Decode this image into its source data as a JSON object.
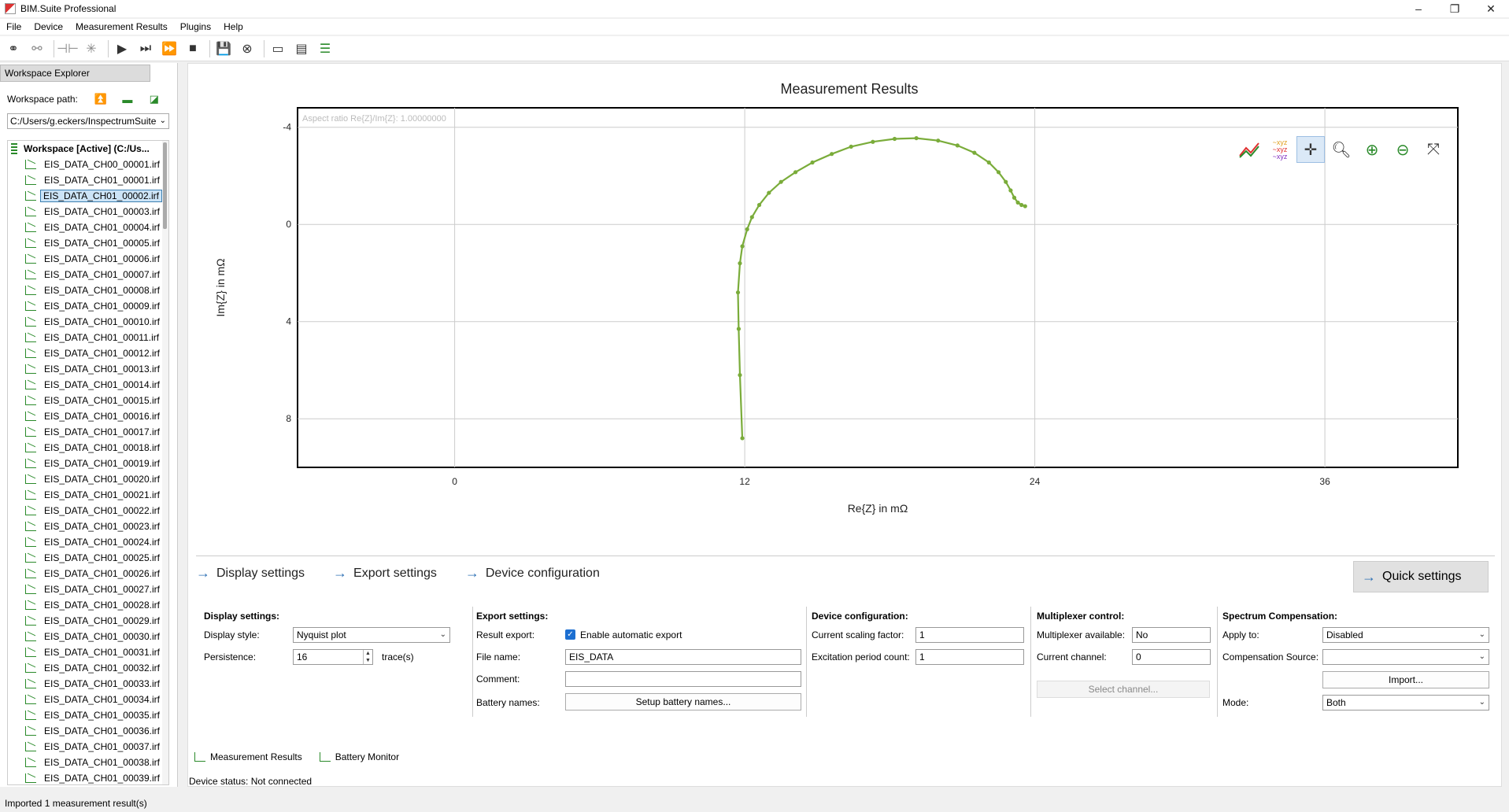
{
  "window": {
    "title": "BIM.Suite Professional",
    "controls": [
      "–",
      "❐",
      "✕"
    ]
  },
  "menu": [
    "File",
    "Device",
    "Measurement Results",
    "Plugins",
    "Help"
  ],
  "left": {
    "header": "Workspace Explorer",
    "workspace_label": "Workspace path:",
    "workspace_path": "C:/Users/g.eckers/InspectrumSuite",
    "root": "Workspace [Active] (C:/Us...",
    "items": [
      "EIS_DATA_CH00_00001.irf",
      "EIS_DATA_CH01_00001.irf",
      "EIS_DATA_CH01_00002.irf",
      "EIS_DATA_CH01_00003.irf",
      "EIS_DATA_CH01_00004.irf",
      "EIS_DATA_CH01_00005.irf",
      "EIS_DATA_CH01_00006.irf",
      "EIS_DATA_CH01_00007.irf",
      "EIS_DATA_CH01_00008.irf",
      "EIS_DATA_CH01_00009.irf",
      "EIS_DATA_CH01_00010.irf",
      "EIS_DATA_CH01_00011.irf",
      "EIS_DATA_CH01_00012.irf",
      "EIS_DATA_CH01_00013.irf",
      "EIS_DATA_CH01_00014.irf",
      "EIS_DATA_CH01_00015.irf",
      "EIS_DATA_CH01_00016.irf",
      "EIS_DATA_CH01_00017.irf",
      "EIS_DATA_CH01_00018.irf",
      "EIS_DATA_CH01_00019.irf",
      "EIS_DATA_CH01_00020.irf",
      "EIS_DATA_CH01_00021.irf",
      "EIS_DATA_CH01_00022.irf",
      "EIS_DATA_CH01_00023.irf",
      "EIS_DATA_CH01_00024.irf",
      "EIS_DATA_CH01_00025.irf",
      "EIS_DATA_CH01_00026.irf",
      "EIS_DATA_CH01_00027.irf",
      "EIS_DATA_CH01_00028.irf",
      "EIS_DATA_CH01_00029.irf",
      "EIS_DATA_CH01_00030.irf",
      "EIS_DATA_CH01_00031.irf",
      "EIS_DATA_CH01_00032.irf",
      "EIS_DATA_CH01_00033.irf",
      "EIS_DATA_CH01_00034.irf",
      "EIS_DATA_CH01_00035.irf",
      "EIS_DATA_CH01_00036.irf",
      "EIS_DATA_CH01_00037.irf",
      "EIS_DATA_CH01_00038.irf",
      "EIS_DATA_CH01_00039.irf"
    ],
    "selected_index": 2
  },
  "chart_data": {
    "type": "scatter",
    "title": "Measurement Results",
    "annotation": "Aspect ratio Re{Z}/Im{Z}: 1.00000000",
    "xlabel": "Re{Z} in mΩ",
    "ylabel": "Im{Z} in mΩ",
    "xlim": [
      -6.5,
      41.5
    ],
    "ylim": [
      -4.8,
      10
    ],
    "y_inverted": true,
    "xticks": [
      0,
      12,
      24,
      36
    ],
    "yticks": [
      -4,
      0,
      4,
      8
    ],
    "grid": true,
    "line_color": "#7aac3a",
    "series": [
      {
        "x": [
          11.9,
          11.8,
          11.75,
          11.72,
          11.8,
          11.9,
          12.1,
          12.3,
          12.6,
          13.0,
          13.5,
          14.1,
          14.8,
          15.6,
          16.4,
          17.3,
          18.2,
          19.1,
          20.0,
          20.8,
          21.5,
          22.1,
          22.5,
          22.8,
          23.0,
          23.15,
          23.3,
          23.45,
          23.6
        ],
        "y": [
          8.8,
          6.2,
          4.3,
          2.8,
          1.6,
          0.9,
          0.2,
          -0.3,
          -0.8,
          -1.3,
          -1.75,
          -2.15,
          -2.55,
          -2.9,
          -3.2,
          -3.4,
          -3.52,
          -3.55,
          -3.45,
          -3.25,
          -2.95,
          -2.55,
          -2.15,
          -1.75,
          -1.4,
          -1.1,
          -0.9,
          -0.8,
          -0.75
        ]
      }
    ]
  },
  "chart_tools": [
    "trend-icon",
    "xyz-icon",
    "pan-icon",
    "zoom-icon",
    "zoom-in-icon",
    "zoom-out-icon",
    "fit-icon"
  ],
  "settings_tabs": {
    "display": "Display settings",
    "export": "Export settings",
    "device": "Device configuration",
    "quick": "Quick settings"
  },
  "display_settings": {
    "title": "Display settings:",
    "style_label": "Display style:",
    "style_value": "Nyquist plot",
    "persistence_label": "Persistence:",
    "persistence_value": "16",
    "persistence_unit": "trace(s)"
  },
  "export_settings": {
    "title": "Export settings:",
    "result_export_label": "Result export:",
    "enable_auto_export": "Enable automatic export",
    "filename_label": "File name:",
    "filename_value": "EIS_DATA",
    "comment_label": "Comment:",
    "comment_value": "",
    "battery_names_label": "Battery names:",
    "setup_battery_button": "Setup battery names..."
  },
  "device_configuration": {
    "title": "Device configuration:",
    "scaling_label": "Current scaling factor:",
    "scaling_value": "1",
    "excitation_label": "Excitation period count:",
    "excitation_value": "1"
  },
  "multiplexer": {
    "title": "Multiplexer control:",
    "available_label": "Multiplexer available:",
    "available_value": "No",
    "channel_label": "Current channel:",
    "channel_value": "0",
    "select_channel_button": "Select channel..."
  },
  "spectrum_compensation": {
    "title": "Spectrum Compensation:",
    "apply_label": "Apply to:",
    "apply_value": "Disabled",
    "source_label": "Compensation Source:",
    "source_value": "",
    "import_button": "Import...",
    "mode_label": "Mode:",
    "mode_value": "Both"
  },
  "bottom_tabs": [
    "Measurement Results",
    "Battery Monitor"
  ],
  "device_status": "Device status:  Not connected",
  "status_bar": "Imported 1 measurement result(s)"
}
